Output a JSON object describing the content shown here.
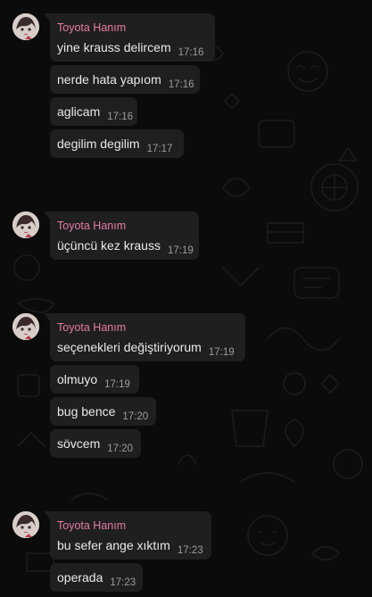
{
  "chat": {
    "groups": [
      {
        "sender": "Toyota Hanım",
        "messages": [
          {
            "text": "yine krauss delircem",
            "time": "17:16"
          },
          {
            "text": "nerde hata yapıom",
            "time": "17:16"
          },
          {
            "text": "aglicam",
            "time": "17:16"
          },
          {
            "text": "degilim degilim",
            "time": "17:17"
          }
        ]
      },
      {
        "sender": "Toyota Hanım",
        "messages": [
          {
            "text": "üçüncü kez krauss",
            "time": "17:19"
          }
        ]
      },
      {
        "sender": "Toyota Hanım",
        "messages": [
          {
            "text": "seçenekleri değiştiriyorum",
            "time": "17:19"
          },
          {
            "text": "olmuyo",
            "time": "17:19"
          },
          {
            "text": "bug bence",
            "time": "17:20"
          },
          {
            "text": "sövcem",
            "time": "17:20"
          }
        ]
      },
      {
        "sender": "Toyota Hanım",
        "messages": [
          {
            "text": "bu sefer ange xıktım",
            "time": "17:23"
          },
          {
            "text": "operada",
            "time": "17:23"
          }
        ]
      }
    ]
  },
  "colors": {
    "background": "#0b0b0b",
    "bubble": "#1f1f1f",
    "sender_name": "#e57ba8",
    "message_text": "#e9e9e9",
    "timestamp": "#9c9c9c"
  }
}
